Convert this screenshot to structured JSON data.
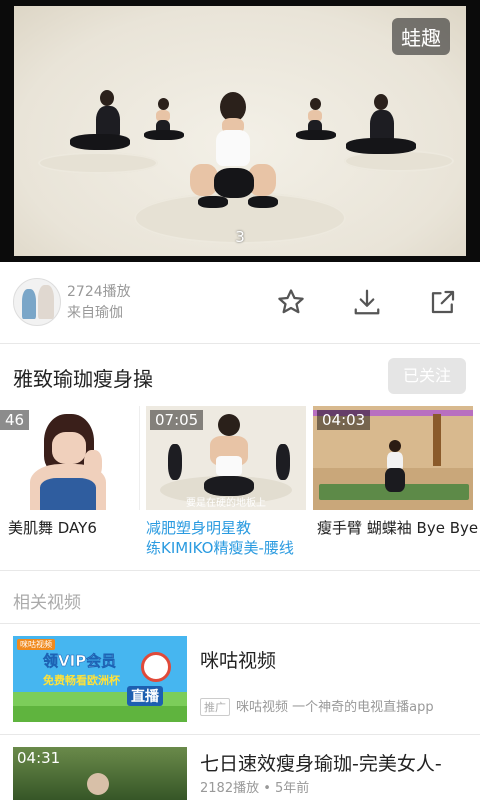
{
  "player": {
    "watermark": "蛙趣",
    "frame_number": "3"
  },
  "info": {
    "play_count": "2724播放",
    "source": "来自瑜伽"
  },
  "album": {
    "title": "雅致瑜珈瘦身操",
    "follow_label": "已关注",
    "videos": [
      {
        "duration": "46",
        "caption": "美肌舞 DAY6"
      },
      {
        "duration": "07:05",
        "caption_line1": "减肥塑身明星教",
        "caption_line2": "练KIMIKO精瘦美-腰线",
        "subtitle": "要是在硬的地板上"
      },
      {
        "duration": "04:03",
        "caption": "瘦手臂 蝴蝶袖 Bye Bye"
      }
    ]
  },
  "related": {
    "header": "相关视频",
    "items": [
      {
        "title": "咪咕视频",
        "ad_tag": "推广",
        "desc": "咪咕视频 一个神奇的电视直播app",
        "banner_line1": "领VIP会员",
        "banner_line2": "免费畅看欧洲杯",
        "banner_line3": "直播"
      },
      {
        "duration": "04:31",
        "title": "七日速效瘦身瑜珈-完美女人-",
        "meta": "2182播放 • 5年前"
      }
    ]
  },
  "colors": {
    "accent": "#2b9be0",
    "muted": "#999999",
    "divider": "#e8e8e8"
  }
}
